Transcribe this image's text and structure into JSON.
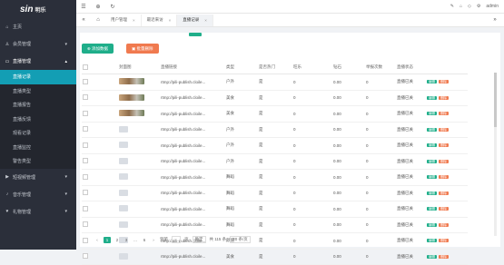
{
  "brand": {
    "mark": "sin",
    "name": "明乐"
  },
  "sidebar": {
    "items": [
      {
        "label": "主页",
        "icon": "home-icon"
      },
      {
        "label": "会员管理",
        "icon": "user-icon"
      },
      {
        "label": "直播管理",
        "icon": "video-icon",
        "open": true,
        "children": [
          "直播记录",
          "直播类型",
          "直播报告",
          "直播反馈",
          "观看记录",
          "直播监控",
          "警告类型"
        ]
      },
      {
        "label": "短视频管理",
        "icon": "film-icon"
      },
      {
        "label": "音乐管理",
        "icon": "music-icon"
      },
      {
        "label": "礼物管理",
        "icon": "gift-icon"
      }
    ]
  },
  "topbar": {
    "user": "admin"
  },
  "tabs": [
    {
      "label": "用户管理"
    },
    {
      "label": "最近来访"
    },
    {
      "label": "直播记录",
      "active": true
    }
  ],
  "toolbar": {
    "add_label": "添加数据",
    "delete_label": "批量删除"
  },
  "table": {
    "headers": [
      "封面图",
      "直播链接",
      "类型",
      "是否热门",
      "旺乐",
      "钻石",
      "举报次数",
      "直播状态"
    ],
    "rows": [
      {
        "thumb": "food",
        "link": "rtmp://pili-publish.cloile...",
        "type": "户外",
        "hot": "是",
        "wang": "0",
        "diamond": "0.00",
        "reports": "0",
        "status": "直播已关"
      },
      {
        "thumb": "food",
        "link": "rtmp://pili-publish.cloile...",
        "type": "美食",
        "hot": "是",
        "wang": "0",
        "diamond": "0.00",
        "reports": "0",
        "status": "直播已关"
      },
      {
        "thumb": "food",
        "link": "rtmp://pili-publish.cloile...",
        "type": "美食",
        "hot": "是",
        "wang": "0",
        "diamond": "0.00",
        "reports": "0",
        "status": "直播已关"
      },
      {
        "thumb": "blur",
        "link": "rtmp://pili-publish.cloile...",
        "type": "户外",
        "hot": "是",
        "wang": "0",
        "diamond": "0.00",
        "reports": "0",
        "status": "直播已关"
      },
      {
        "thumb": "blur",
        "link": "rtmp://pili-publish.cloile...",
        "type": "户外",
        "hot": "是",
        "wang": "0",
        "diamond": "0.00",
        "reports": "0",
        "status": "直播已关"
      },
      {
        "thumb": "blur",
        "link": "rtmp://pili-publish.cloile...",
        "type": "户外",
        "hot": "是",
        "wang": "0",
        "diamond": "0.00",
        "reports": "0",
        "status": "直播已关"
      },
      {
        "thumb": "blur",
        "link": "rtmp://pili-publish.cloile...",
        "type": "舞蹈",
        "hot": "是",
        "wang": "0",
        "diamond": "0.00",
        "reports": "0",
        "status": "直播已关"
      },
      {
        "thumb": "blur",
        "link": "rtmp://pili-publish.cloile...",
        "type": "舞蹈",
        "hot": "是",
        "wang": "0",
        "diamond": "0.00",
        "reports": "0",
        "status": "直播已关"
      },
      {
        "thumb": "blur",
        "link": "rtmp://pili-publish.cloile...",
        "type": "舞蹈",
        "hot": "是",
        "wang": "0",
        "diamond": "0.00",
        "reports": "0",
        "status": "直播已关"
      },
      {
        "thumb": "blur",
        "link": "rtmp://pili-publish.cloile...",
        "type": "舞蹈",
        "hot": "是",
        "wang": "0",
        "diamond": "0.00",
        "reports": "0",
        "status": "直播已关"
      },
      {
        "thumb": "blur",
        "link": "rtmp://pili-publish.cloile...",
        "type": "颜值",
        "hot": "是",
        "wang": "0",
        "diamond": "0.00",
        "reports": "0",
        "status": "直播已关"
      },
      {
        "thumb": "blur",
        "link": "rtmp://pili-publish.cloile...",
        "type": "美食",
        "hot": "是",
        "wang": "0",
        "diamond": "0.00",
        "reports": "0",
        "status": "直播已关"
      }
    ],
    "edit_label": "编辑",
    "delete_label": "删除"
  },
  "pagination": {
    "pages": [
      "1",
      "2",
      "3",
      "...",
      "6"
    ],
    "current": "1",
    "next": "›",
    "goto_label": "到第",
    "page_unit": "页",
    "confirm_label": "确定",
    "total": "共 115 条",
    "page_size": "20 条/页"
  },
  "colors": {
    "accent": "#1fae8a",
    "danger": "#f07a4f",
    "sidebar": "#2b2f3a",
    "active": "#139eb4"
  }
}
